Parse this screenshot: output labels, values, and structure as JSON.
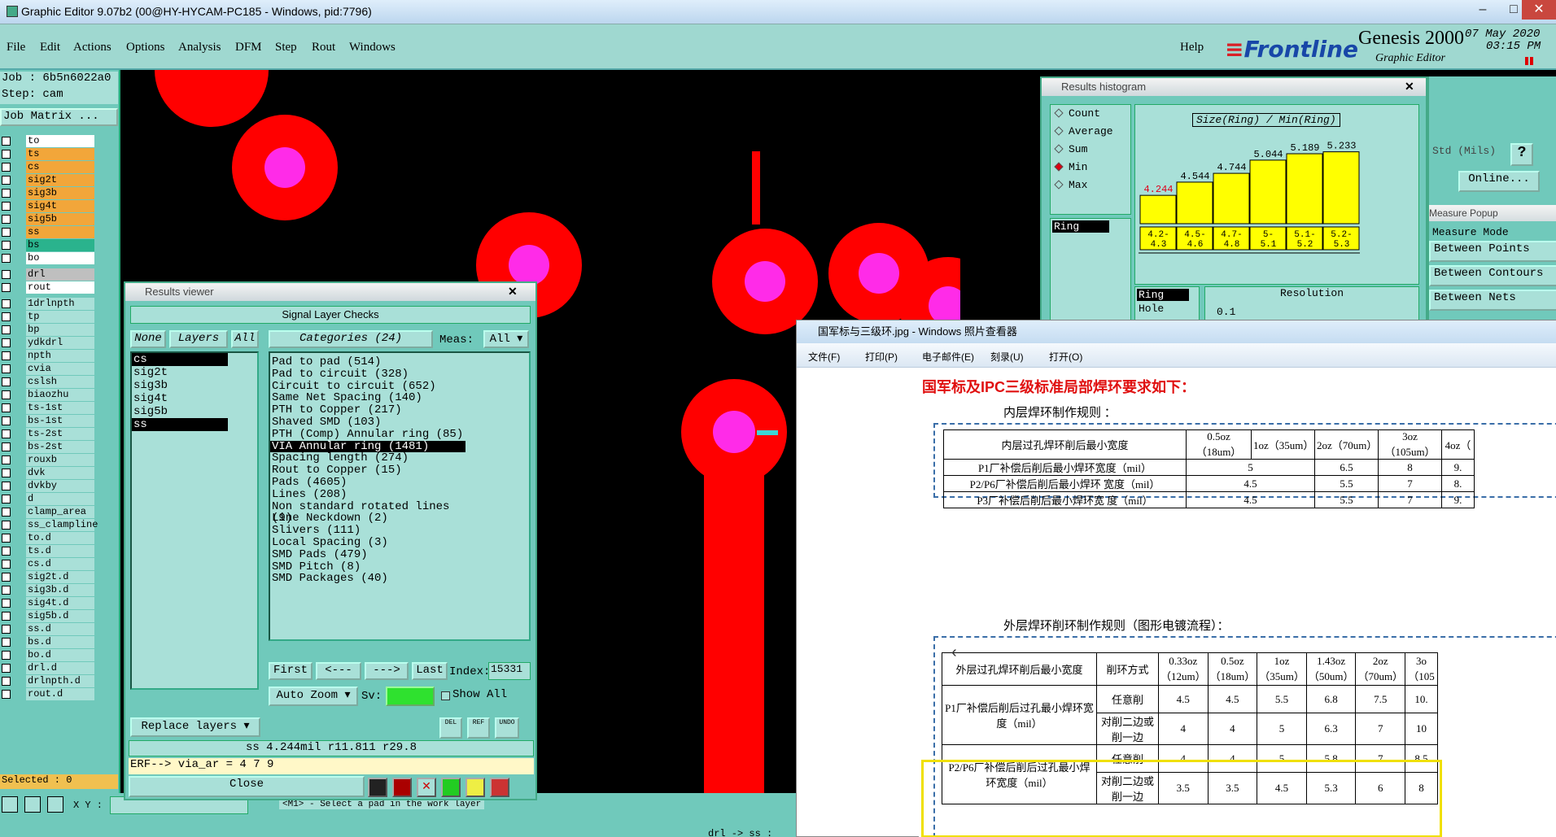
{
  "app": {
    "title": "Graphic Editor 9.07b2 (00@HY-HYCAM-PC185 - Windows, pid:7796)",
    "menu": [
      "File",
      "Edit",
      "Actions",
      "Options",
      "Analysis",
      "DFM",
      "Step",
      "Rout",
      "Windows"
    ],
    "help": "Help",
    "brand": "Frontline",
    "product": "Genesis 2000",
    "subtitle": "Graphic Editor",
    "date": "07 May 2020",
    "time": "03:15 PM"
  },
  "left": {
    "job": "Job : 6b5n6022a0",
    "step": "Step: cam",
    "job_matrix": "Job Matrix ...",
    "selected": "Selected : 0",
    "counts": "4 7 9",
    "xy_label": "X Y :",
    "layers_top": [
      {
        "name": "to",
        "color": "#ffffff"
      },
      {
        "name": "ts",
        "color": "#f2a63a"
      },
      {
        "name": "cs",
        "color": "#f2a63a"
      },
      {
        "name": "sig2t",
        "color": "#f2a63a"
      },
      {
        "name": "sig3b",
        "color": "#f2a63a"
      },
      {
        "name": "sig4t",
        "color": "#f2a63a"
      },
      {
        "name": "sig5b",
        "color": "#f2a63a"
      },
      {
        "name": "ss",
        "color": "#f2a63a"
      },
      {
        "name": "bs",
        "color": "#2ab38d"
      },
      {
        "name": "bo",
        "color": "#ffffff"
      }
    ],
    "layers_drill": [
      {
        "name": "drl",
        "color": "#bfbfbf"
      },
      {
        "name": "rout",
        "color": "#ffffff"
      }
    ],
    "layers_misc": [
      "1drlnpth",
      "tp",
      "bp",
      "ydkdrl",
      "npth",
      "cvia",
      "cslsh",
      "biaozhu",
      "ts-1st",
      "bs-1st",
      "ts-2st",
      "bs-2st",
      "rouxb",
      "dvk",
      "dvkby",
      "d",
      "clamp_area",
      "ss_clampline",
      "to.d",
      "ts.d",
      "cs.d",
      "sig2t.d",
      "sig3b.d",
      "sig4t.d",
      "sig5b.d",
      "ss.d",
      "bs.d",
      "bo.d",
      "drl.d",
      "drlnpth.d",
      "rout.d"
    ]
  },
  "results_viewer": {
    "title": "Results viewer",
    "header": "Signal Layer Checks",
    "none": "None",
    "layers": "Layers",
    "all": "All",
    "categories_label": "Categories (24)",
    "meas_label": "Meas:",
    "meas_value": "All",
    "layer_list": [
      "cs",
      "sig2t",
      "sig3b",
      "sig4t",
      "sig5b",
      "ss"
    ],
    "categories": [
      "Pad to pad (514)",
      "Pad to circuit (328)",
      "Circuit to circuit (652)",
      "Same Net Spacing (140)",
      "PTH to Copper (217)",
      "Shaved SMD (103)",
      "PTH (Comp) Annular ring (85)",
      "VIA Annular ring (1481)",
      "Spacing length (274)",
      "Rout to Copper (15)",
      "Pads (4605)",
      "Lines (208)",
      "Non standard rotated lines (9)",
      "Line Neckdown (2)",
      "Slivers (111)",
      "Local Spacing (3)",
      "SMD Pads (479)",
      "SMD Pitch (8)",
      "SMD Packages (40)"
    ],
    "selected_category": "VIA Annular ring (1481)",
    "nav": {
      "first": "First",
      "prev": "<---",
      "next": "--->",
      "last": "Last",
      "index_label": "Index:",
      "index_value": "15331"
    },
    "auto_zoom": "Auto Zoom",
    "sv": "Sv:",
    "show_all": "Show All",
    "replace_layers": "Replace layers",
    "del": "DEL",
    "ref": "REF",
    "undo": "UNDO",
    "status": "ss 4.244mil  r11.811  r29.8",
    "erf": "ERF--> via_ar = ",
    "close": "Close"
  },
  "histogram": {
    "title": "Results histogram",
    "options": [
      "Count",
      "Average",
      "Sum",
      "Min",
      "Max"
    ],
    "selected": "Min",
    "chart_title": "Size(Ring) / Min(Ring)",
    "ring": "Ring",
    "hole": "Hole",
    "resolution": "Resolution",
    "resolution_value": "0.1"
  },
  "chart_data": {
    "type": "bar",
    "title": "Size(Ring) / Min(Ring)",
    "categories": [
      "4.2-4.3",
      "4.5-4.6",
      "4.7-4.8",
      "5-5.1",
      "5.1-5.2",
      "5.2-5.3"
    ],
    "values": [
      4.244,
      4.544,
      4.744,
      5.044,
      5.189,
      5.233
    ],
    "colors": {
      "bar": "#ffff00",
      "first_label": "#e0001b"
    }
  },
  "measure": {
    "std": "Std (Mils)",
    "help": "?",
    "online": "Online...",
    "popup": "Measure Popup",
    "mode": "Measure Mode",
    "items": [
      "Between Points",
      "Between Contours",
      "Between Nets"
    ]
  },
  "bottom": {
    "prompt": "<M1> - Select a pad in the work layer",
    "drl": "drl -> ss : 0.0"
  },
  "photo": {
    "title": "国军标与三级环.jpg - Windows 照片查看器",
    "toolbar": [
      "文件(F)",
      "打印(P)",
      "电子邮件(E)",
      "刻录(U)",
      "打开(O)"
    ],
    "heading": "国军标及IPC三级标准局部焊环要求如下：",
    "inner_title": "内层焊环制作规则 ：",
    "inner_header": [
      "内层过孔焊环削后最小宽度",
      "0.5oz（18um）",
      "1oz（35um）",
      "2oz（70um）",
      "3oz（105um）",
      "4oz（"
    ],
    "inner_rows": [
      [
        "P1厂补偿后削后最小焊环宽度（mil）",
        "5",
        "6.5",
        "8",
        "9."
      ],
      [
        "P2/P6厂补偿后削后最小焊环 宽度（mil）",
        "4.5",
        "5.5",
        "7",
        "8."
      ],
      [
        "P3厂补偿后削后最小焊环宽 度（mil）",
        "4.5",
        "5.5",
        "7",
        "9."
      ]
    ],
    "outer_title": "外层焊环削环制作规则（图形电镀流程）：",
    "outer_header": [
      "外层过孔焊环削后最小宽度",
      "削环方式",
      "0.33oz（12um）",
      "0.5oz（18um）",
      "1oz（35um）",
      "1.43oz（50um）",
      "2oz（70um）",
      "3o（105"
    ],
    "outer_p1": "P1厂补偿后削后过孔最小焊环宽度（mil）",
    "outer_p2": "P2/P6厂补偿后削后过孔最小焊环宽度（mil）",
    "m1": "任意削",
    "m2": "对削二边或削一边",
    "p1_row1": [
      "4.5",
      "4.5",
      "5.5",
      "6.8",
      "7.5",
      "10."
    ],
    "p1_row2": [
      "4",
      "4",
      "5",
      "6.3",
      "7",
      "10"
    ],
    "p2_row1": [
      "4",
      "4",
      "5",
      "5.8",
      "7",
      "8.5"
    ],
    "p2_row2": [
      "3.5",
      "3.5",
      "4.5",
      "5.3",
      "6",
      "8"
    ],
    "highlight_color": "#f0e000"
  }
}
